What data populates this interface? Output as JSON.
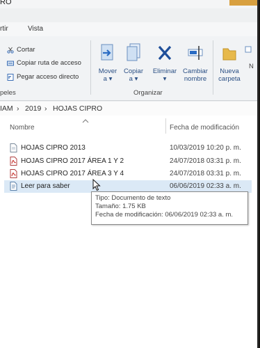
{
  "window": {
    "title": "RO"
  },
  "menu": {
    "items": [
      "rtir",
      "Vista"
    ]
  },
  "ribbon": {
    "clipboard": {
      "cut": "Cortar",
      "copy_path": "Copiar ruta de acceso",
      "paste_shortcut": "Pegar acceso directo",
      "group_label": "peles"
    },
    "organize": {
      "move_to": [
        "Mover",
        "a ▾"
      ],
      "copy_to": [
        "Copiar",
        "a ▾"
      ],
      "delete": [
        "Eliminar",
        "▾"
      ],
      "rename": [
        "Cambiar",
        "nombre"
      ],
      "group_label": "Organizar"
    },
    "new": {
      "new_folder": [
        "Nueva",
        "carpeta"
      ],
      "partial": "N"
    }
  },
  "address": {
    "crumbs": [
      "IAM",
      "2019",
      "HOJAS CIPRO"
    ]
  },
  "columns": {
    "name": "Nombre",
    "modified": "Fecha de modificación"
  },
  "files": [
    {
      "name": "HOJAS CIPRO 2013",
      "modified": "10/03/2019 10:20 p. m.",
      "icon": "generic-file-icon"
    },
    {
      "name": "HOJAS CIPRO 2017 ÁREA 1 Y 2",
      "modified": "24/07/2018 03:31 p. m.",
      "icon": "pdf-file-icon"
    },
    {
      "name": "HOJAS CIPRO 2017 ÁREA 3 Y 4",
      "modified": "24/07/2018 03:31 p. m.",
      "icon": "pdf-file-icon"
    },
    {
      "name": "Leer para saber",
      "modified": "06/06/2019 02:33 a. m.",
      "icon": "text-file-icon"
    }
  ],
  "tooltip": {
    "type": "Tipo: Documento de texto",
    "size": "Tamaño: 1.75 KB",
    "modified": "Fecha de modificación: 06/06/2019 02:33 a. m."
  },
  "colors": {
    "accent": "#2a6cc4",
    "hover_row": "#dbe9f6",
    "pdf_red": "#c8302a"
  }
}
